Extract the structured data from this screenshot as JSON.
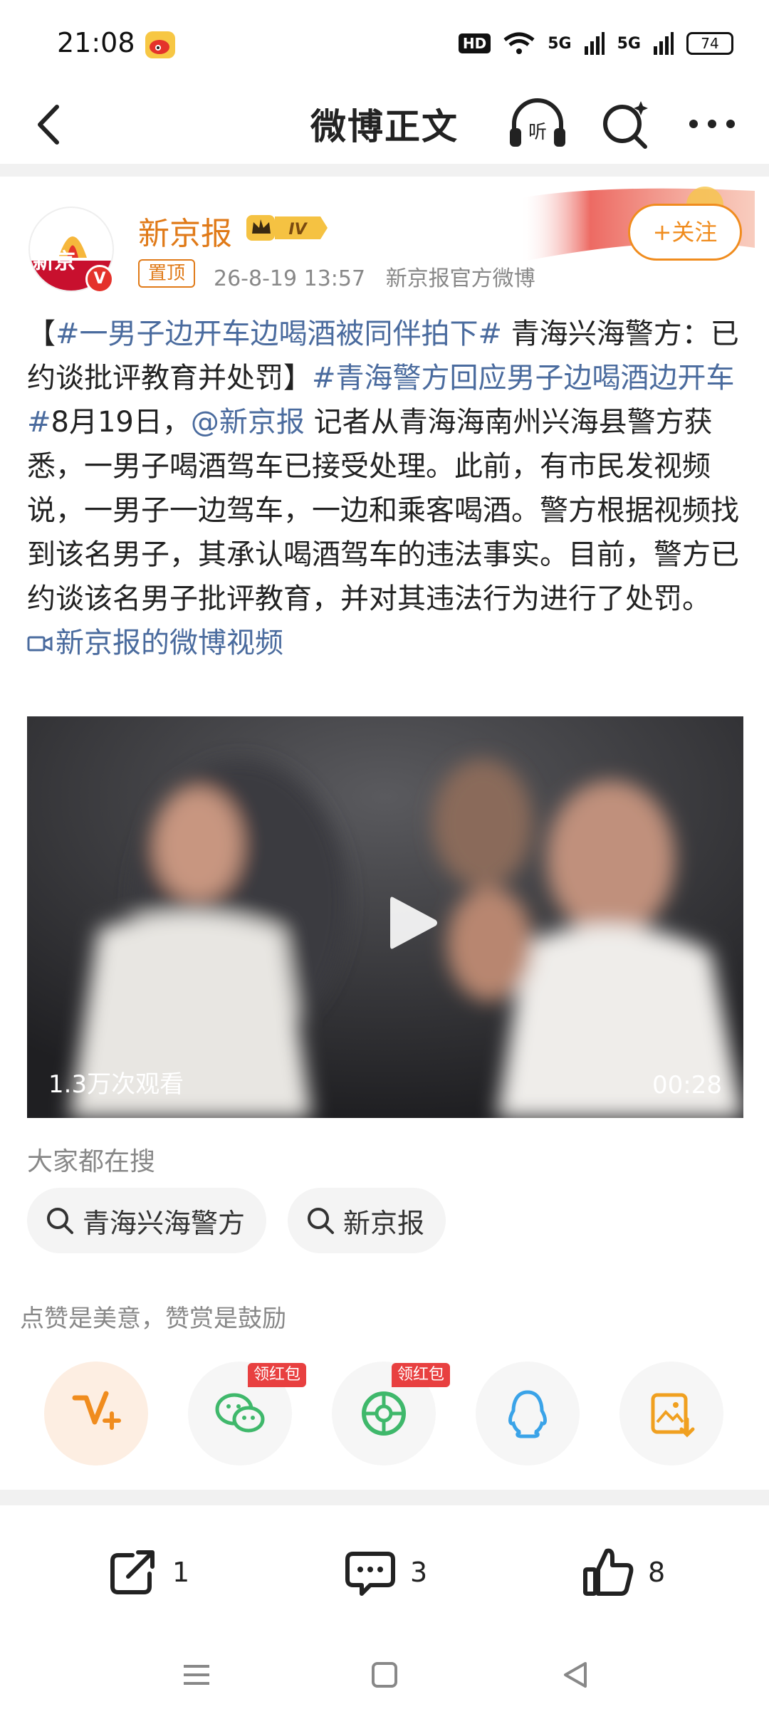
{
  "status_bar": {
    "time": "21:08",
    "network_hd": "HD",
    "signal_1": "5G",
    "signal_2": "5G",
    "battery": "74"
  },
  "nav": {
    "title": "微博正文",
    "listen_icon_text": "听"
  },
  "post": {
    "author": "新京报",
    "avatar_text": "新京",
    "verified_badge": "V",
    "level_badge": "IV",
    "pin_label": "置顶",
    "timestamp": "26-8-19 13:57",
    "source": "新京报官方微博",
    "follow_label": "+关注",
    "text_segments": {
      "bracket_open": "【",
      "hashtag_1": "#一男子边开车边喝酒被同伴拍下#",
      "headline": " 青海兴海警方：已约谈批评教育并处罚】",
      "hashtag_2": "#青海警方回应男子边喝酒边开车#",
      "date_text": "8月19日，",
      "mention": "@新京报",
      "body": " 记者从青海海南州兴海县警方获悉，一男子喝酒驾车已接受处理。此前，有市民发视频说，一男子一边驾车，一边和乘客喝酒。警方根据视频找到该名男子，其承认喝酒驾车的违法事实。目前，警方已约谈该名男子批评教育，并对其违法行为进行了处罚。 ",
      "video_link": "新京报的微博视频"
    },
    "video": {
      "views": "1.3万次观看",
      "duration": "00:28"
    }
  },
  "search_section": {
    "label": "大家都在搜",
    "chips": [
      "青海兴海警方",
      "新京报"
    ]
  },
  "reward": {
    "hint": "点赞是美意，赞赏是鼓励",
    "hongbao_label": "领红包"
  },
  "share_targets": [
    "reward",
    "wechat",
    "moments",
    "qq",
    "save-image"
  ],
  "actions": {
    "repost_count": "1",
    "comment_count": "3",
    "like_count": "8"
  },
  "colors": {
    "accent_orange": "#f08c1e",
    "link_blue": "#4a6b9e",
    "author_orange": "#e07a18",
    "hongbao_red": "#e84040"
  }
}
